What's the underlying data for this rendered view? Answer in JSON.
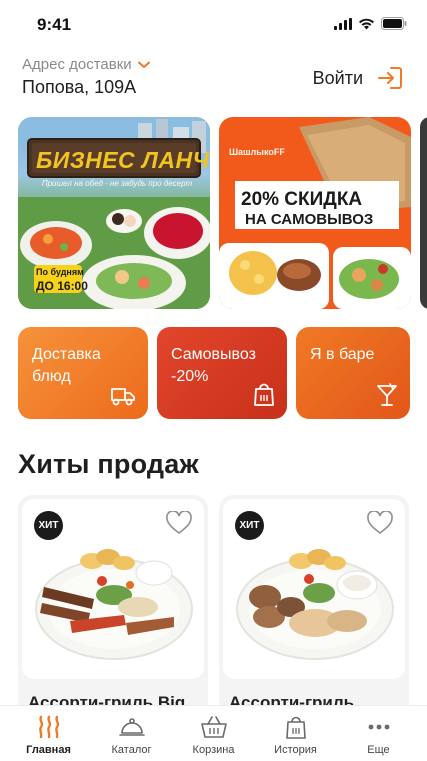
{
  "status_bar": {
    "time": "9:41"
  },
  "header": {
    "address_label": "Адрес доставки",
    "address_value": "Попова, 109А",
    "login_label": "Войти"
  },
  "banners": [
    {
      "title": "БИЗНЕС ЛАНЧ",
      "subtitle": "Пришел на обед - не забудь про десерт",
      "badge_line1": "По будням",
      "badge_line2": "до 16:00"
    },
    {
      "brand": "ШашлыкоFF",
      "headline_line1": "20% СКИДКА",
      "headline_line2": "НА САМОВЫВОЗ"
    }
  ],
  "chips": [
    {
      "label": "Доставка блюд",
      "icon": "delivery-truck-icon"
    },
    {
      "label": "Самовывоз -20%",
      "icon": "takeaway-bag-icon"
    },
    {
      "label": "Я в баре",
      "icon": "cocktail-icon"
    }
  ],
  "section_title": "Хиты продаж",
  "products": [
    {
      "badge": "ХИТ",
      "name": "Ассорти-гриль Big"
    },
    {
      "badge": "ХИТ",
      "name": "Ассорти-гриль"
    }
  ],
  "tabbar": {
    "items": [
      {
        "label": "Главная",
        "icon": "home-flame-icon",
        "active": true
      },
      {
        "label": "Каталог",
        "icon": "cloche-icon",
        "active": false
      },
      {
        "label": "Корзина",
        "icon": "basket-icon",
        "active": false
      },
      {
        "label": "История",
        "icon": "history-bag-icon",
        "active": false
      },
      {
        "label": "Еще",
        "icon": "more-dots-icon",
        "active": false
      }
    ]
  },
  "colors": {
    "accent": "#f07a25",
    "red": "#d93a22",
    "dark": "#1f1f1f"
  }
}
